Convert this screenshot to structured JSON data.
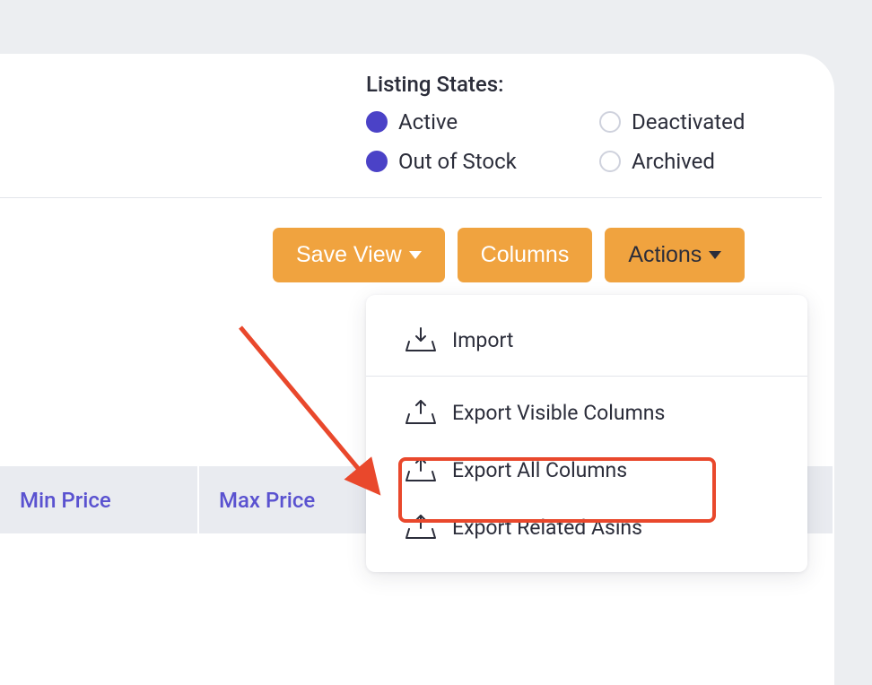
{
  "listing_states": {
    "title": "Listing States:",
    "options": [
      {
        "label": "Active",
        "checked": true
      },
      {
        "label": "Deactivated",
        "checked": false
      },
      {
        "label": "Out of Stock",
        "checked": true
      },
      {
        "label": "Archived",
        "checked": false
      }
    ]
  },
  "toolbar": {
    "save_view_label": "Save View",
    "columns_label": "Columns",
    "actions_label": "Actions"
  },
  "actions_menu": {
    "import": "Import",
    "export_visible": "Export Visible Columns",
    "export_all": "Export All Columns",
    "export_related": "Export Related Asins"
  },
  "table": {
    "columns": [
      "Min Price",
      "Max Price"
    ]
  },
  "colors": {
    "accent_orange": "#f0a33f",
    "accent_purple": "#4b42c7",
    "highlight_red": "#e9482c"
  }
}
